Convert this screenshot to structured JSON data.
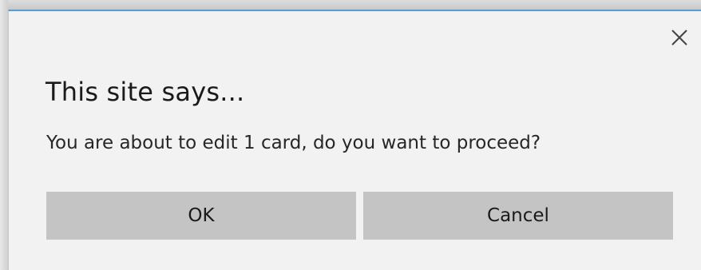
{
  "dialog": {
    "title": "This site says...",
    "message": "You are about to edit 1 card, do you want to proceed?",
    "ok_label": "OK",
    "cancel_label": "Cancel",
    "close_icon": "close-icon",
    "accent_color": "#5b9bd5",
    "button_color": "#c4c4c4"
  }
}
